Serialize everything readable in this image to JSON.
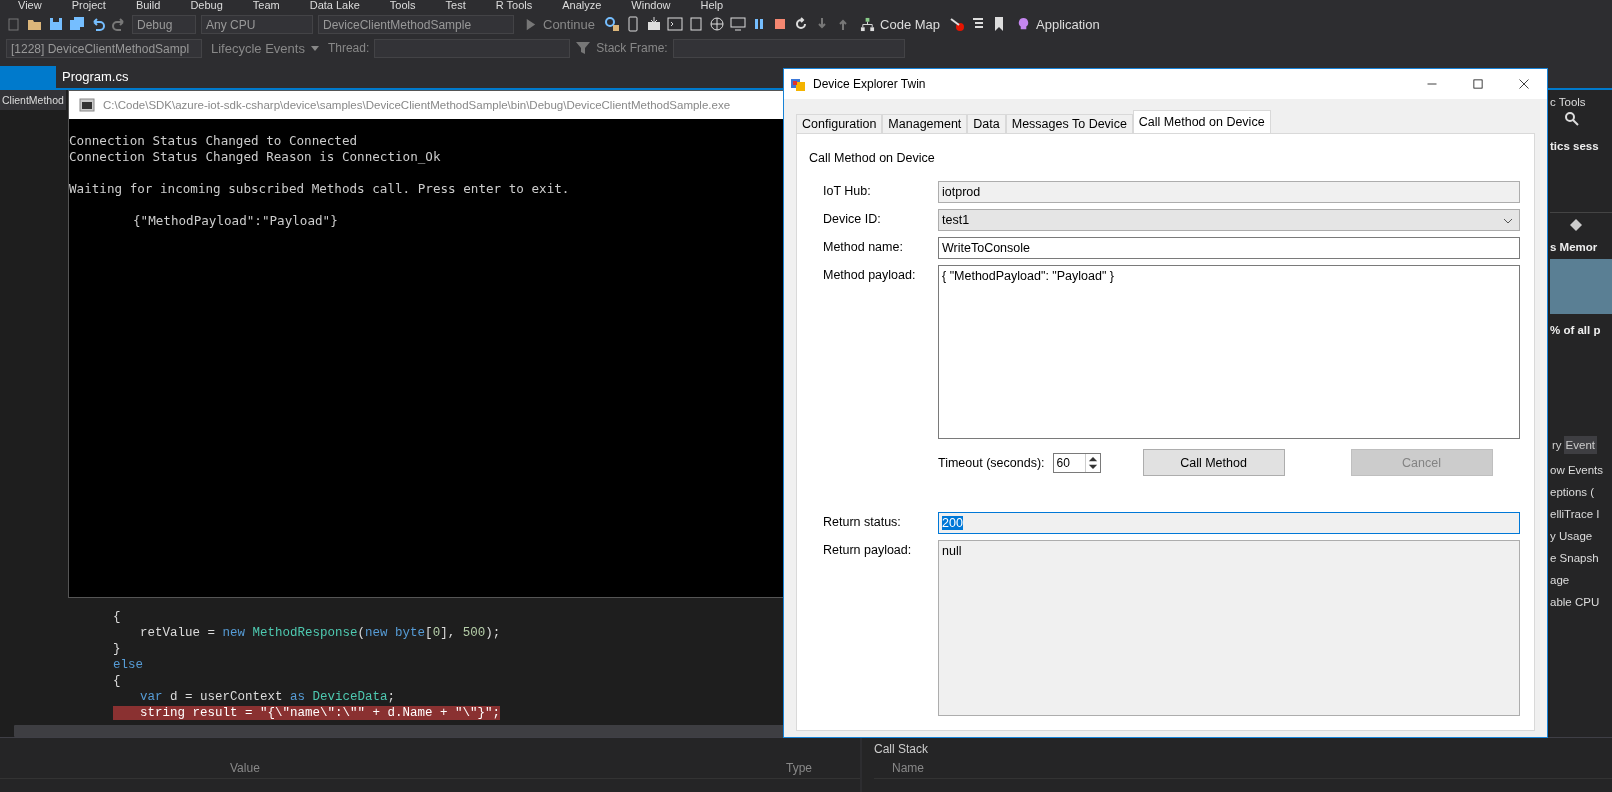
{
  "menu": [
    "View",
    "Project",
    "Build",
    "Debug",
    "Team",
    "Data Lake",
    "Tools",
    "Test",
    "R Tools",
    "Analyze",
    "Window",
    "Help"
  ],
  "toolbar": {
    "configuration": "Debug",
    "platform": "Any CPU",
    "startup_project": "DeviceClientMethodSample",
    "continue_label": "Continue",
    "code_map_label": "Code Map",
    "application_label": "Application"
  },
  "debug_location": {
    "process": "[1228] DeviceClientMethodSampl",
    "lifecycle_label": "Lifecycle Events",
    "thread_label": "Thread:",
    "stack_frame_label": "Stack Frame:"
  },
  "editor": {
    "tab": "Program.cs",
    "nav_label": "ClientMethod",
    "code_lines": [
      {
        "indented": false,
        "highlighted": false,
        "tokens": [
          {
            "t": "{",
            "kind": "plain"
          }
        ]
      },
      {
        "indented": true,
        "highlighted": false,
        "tokens": [
          {
            "t": "retValue = ",
            "kind": "plain"
          },
          {
            "t": "new",
            "kind": "keyword"
          },
          {
            "t": " MethodResponse",
            "kind": "type"
          },
          {
            "t": "(",
            "kind": "plain"
          },
          {
            "t": "new",
            "kind": "keyword"
          },
          {
            "t": " byte",
            "kind": "keyword"
          },
          {
            "t": "[",
            "kind": "plain"
          },
          {
            "t": "0",
            "kind": "number"
          },
          {
            "t": "], ",
            "kind": "plain"
          },
          {
            "t": "500",
            "kind": "number"
          },
          {
            "t": ");",
            "kind": "plain"
          }
        ]
      },
      {
        "indented": false,
        "highlighted": false,
        "tokens": [
          {
            "t": "}",
            "kind": "plain"
          }
        ]
      },
      {
        "indented": false,
        "highlighted": false,
        "tokens": [
          {
            "t": "else",
            "kind": "keyword"
          }
        ]
      },
      {
        "indented": false,
        "highlighted": false,
        "tokens": [
          {
            "t": "{",
            "kind": "plain"
          }
        ]
      },
      {
        "indented": true,
        "highlighted": false,
        "tokens": [
          {
            "t": "var",
            "kind": "keyword"
          },
          {
            "t": " d = userContext ",
            "kind": "plain"
          },
          {
            "t": "as",
            "kind": "keyword"
          },
          {
            "t": " DeviceData",
            "kind": "type"
          },
          {
            "t": ";",
            "kind": "plain"
          }
        ]
      },
      {
        "indented": true,
        "highlighted": true,
        "tokens": [
          {
            "t": "string result = \"{\\\"name\\\":\\\"\" + d.Name + \"\\\"}\";",
            "kind": "plain"
          }
        ]
      }
    ]
  },
  "diagnostics": {
    "title": "c Tools",
    "session": "tics sess",
    "memory": "s Memor",
    "percent": "% of all p",
    "tabs": [
      {
        "label": "ry",
        "selected": false
      },
      {
        "label": "Event",
        "selected": true
      }
    ],
    "items": [
      "ow Events",
      "eptions (",
      "elliTrace I",
      "y Usage",
      "e Snapsh",
      "age",
      "able CPU"
    ]
  },
  "locals": {
    "columns": [
      "Value",
      "Type"
    ]
  },
  "call_stack": {
    "title": "Call Stack",
    "columns": [
      "Name"
    ]
  },
  "console": {
    "title": "C:\\Code\\SDK\\azure-iot-sdk-csharp\\device\\samples\\DeviceClientMethodSample\\bin\\Debug\\DeviceClientMethodSample.exe",
    "lines": [
      {
        "text": "Connection Status Changed to Connected",
        "blank_before": false,
        "indented": false
      },
      {
        "text": "Connection Status Changed Reason is Connection_Ok",
        "blank_before": false,
        "indented": false
      },
      {
        "text": "Waiting for incoming subscribed Methods call.  Press enter to exit.",
        "blank_before": true,
        "indented": false
      },
      {
        "text": "{\"MethodPayload\":\"Payload\"}",
        "blank_before": true,
        "indented": true
      }
    ]
  },
  "dialog": {
    "title": "Device Explorer Twin",
    "tabs": [
      {
        "label": "Configuration",
        "selected": false
      },
      {
        "label": "Management",
        "selected": false
      },
      {
        "label": "Data",
        "selected": false
      },
      {
        "label": "Messages To Device",
        "selected": false
      },
      {
        "label": "Call Method on Device",
        "selected": true
      }
    ],
    "group_title": "Call Method on Device",
    "fields": [
      {
        "label": "IoT Hub:",
        "value": "iotprod",
        "kind": "readonly"
      },
      {
        "label": "Device ID:",
        "value": "test1",
        "kind": "dropdown"
      },
      {
        "label": "Method name:",
        "value": "WriteToConsole",
        "kind": "text"
      },
      {
        "label": "Method payload:",
        "value": "{ \"MethodPayload\": \"Payload\" }",
        "kind": "multiline"
      }
    ],
    "timeout": {
      "label": "Timeout (seconds):",
      "value": "60"
    },
    "buttons": [
      {
        "label": "Call Method",
        "disabled": false
      },
      {
        "label": "Cancel",
        "disabled": true
      }
    ],
    "return_status": {
      "label": "Return status:",
      "value": "200",
      "value_selected": true
    },
    "return_payload": {
      "label": "Return payload:",
      "value": "null"
    }
  }
}
